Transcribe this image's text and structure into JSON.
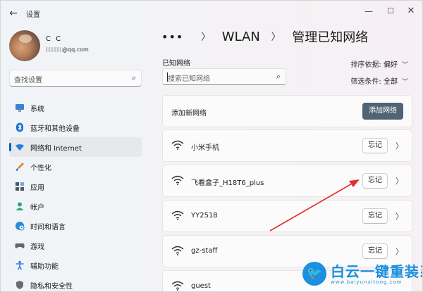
{
  "window": {
    "title": "设置"
  },
  "user": {
    "name": "C C",
    "email_suffix": "@qq.com"
  },
  "sidebar": {
    "search_placeholder": "查找设置",
    "items": [
      {
        "label": "系统",
        "icon": "monitor-icon",
        "color": "#2b6cb0"
      },
      {
        "label": "蓝牙和其他设备",
        "icon": "bluetooth-icon",
        "color": "#1f6fd1"
      },
      {
        "label": "网络和 Internet",
        "icon": "wifi-diamond-icon",
        "color": "#2b7fd6",
        "active": true
      },
      {
        "label": "个性化",
        "icon": "brush-icon",
        "color": "#d98a3a"
      },
      {
        "label": "应用",
        "icon": "apps-icon",
        "color": "#4a5a6a"
      },
      {
        "label": "帐户",
        "icon": "person-icon",
        "color": "#2fa37a"
      },
      {
        "label": "时间和语言",
        "icon": "globe-clock-icon",
        "color": "#2b8ad6"
      },
      {
        "label": "游戏",
        "icon": "gamepad-icon",
        "color": "#666666"
      },
      {
        "label": "辅助功能",
        "icon": "accessibility-icon",
        "color": "#2b7fd6"
      },
      {
        "label": "隐私和安全性",
        "icon": "shield-icon",
        "color": "#6b6b6b"
      }
    ]
  },
  "breadcrumb": {
    "more": "•••",
    "parent": "WLAN",
    "current": "管理已知网络"
  },
  "main": {
    "known_label": "已知网络",
    "search_placeholder": "搜索已知网络",
    "sort_label": "排序依据:",
    "sort_value": "偏好",
    "filter_label": "筛选条件:",
    "filter_value": "全部",
    "add_network_label": "添加新网络",
    "add_network_button": "添加网络",
    "forget_label": "忘记",
    "networks": [
      "小米手机",
      "飞看盒子_H18T6_plus",
      "YY2518",
      "gz-staff",
      "guest"
    ]
  },
  "watermark": {
    "text": "白云一键重装系统",
    "url": "www.baiyunxitong.com"
  },
  "colors": {
    "accent": "#0067c0",
    "add_button": "#4f6475",
    "annotation_arrow": "#e0322e",
    "watermark": "#1b8fe0"
  }
}
